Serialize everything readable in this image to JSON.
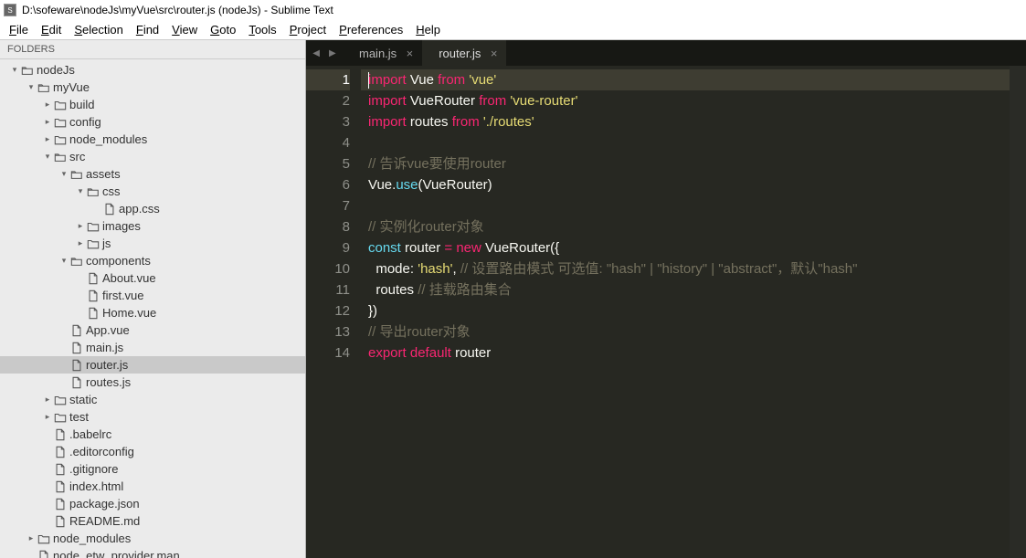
{
  "title": "D:\\sofeware\\nodeJs\\myVue\\src\\router.js (nodeJs) - Sublime Text",
  "menu": [
    "File",
    "Edit",
    "Selection",
    "Find",
    "View",
    "Goto",
    "Tools",
    "Project",
    "Preferences",
    "Help"
  ],
  "sidebar": {
    "header": "FOLDERS"
  },
  "tree": [
    {
      "d": 0,
      "t": "folder",
      "a": "down",
      "n": "nodeJs"
    },
    {
      "d": 1,
      "t": "folder",
      "a": "down",
      "n": "myVue"
    },
    {
      "d": 2,
      "t": "folder",
      "a": "right",
      "n": "build"
    },
    {
      "d": 2,
      "t": "folder",
      "a": "right",
      "n": "config"
    },
    {
      "d": 2,
      "t": "folder",
      "a": "right",
      "n": "node_modules"
    },
    {
      "d": 2,
      "t": "folder",
      "a": "down",
      "n": "src"
    },
    {
      "d": 3,
      "t": "folder",
      "a": "down",
      "n": "assets"
    },
    {
      "d": 4,
      "t": "folder",
      "a": "down",
      "n": "css"
    },
    {
      "d": 5,
      "t": "file",
      "a": "",
      "n": "app.css"
    },
    {
      "d": 4,
      "t": "folder",
      "a": "right",
      "n": "images"
    },
    {
      "d": 4,
      "t": "folder",
      "a": "right",
      "n": "js"
    },
    {
      "d": 3,
      "t": "folder",
      "a": "down",
      "n": "components"
    },
    {
      "d": 4,
      "t": "file",
      "a": "",
      "n": "About.vue"
    },
    {
      "d": 4,
      "t": "file",
      "a": "",
      "n": "first.vue"
    },
    {
      "d": 4,
      "t": "file",
      "a": "",
      "n": "Home.vue"
    },
    {
      "d": 3,
      "t": "file",
      "a": "",
      "n": "App.vue"
    },
    {
      "d": 3,
      "t": "file",
      "a": "",
      "n": "main.js"
    },
    {
      "d": 3,
      "t": "file",
      "a": "",
      "n": "router.js",
      "sel": true
    },
    {
      "d": 3,
      "t": "file",
      "a": "",
      "n": "routes.js"
    },
    {
      "d": 2,
      "t": "folder",
      "a": "right",
      "n": "static"
    },
    {
      "d": 2,
      "t": "folder",
      "a": "right",
      "n": "test"
    },
    {
      "d": 2,
      "t": "file",
      "a": "",
      "n": ".babelrc"
    },
    {
      "d": 2,
      "t": "file",
      "a": "",
      "n": ".editorconfig"
    },
    {
      "d": 2,
      "t": "file",
      "a": "",
      "n": ".gitignore"
    },
    {
      "d": 2,
      "t": "file",
      "a": "",
      "n": "index.html"
    },
    {
      "d": 2,
      "t": "file",
      "a": "",
      "n": "package.json"
    },
    {
      "d": 2,
      "t": "file",
      "a": "",
      "n": "README.md"
    },
    {
      "d": 1,
      "t": "folder",
      "a": "right",
      "n": "node_modules"
    },
    {
      "d": 1,
      "t": "file",
      "a": "",
      "n": "node_etw_provider.man"
    }
  ],
  "tabs": [
    {
      "label": "main.js",
      "active": false
    },
    {
      "label": "router.js",
      "active": true
    }
  ],
  "code": {
    "current_line": 1,
    "lines": [
      [
        {
          "c": "kw",
          "t": "import"
        },
        {
          "c": "pun",
          "t": " Vue "
        },
        {
          "c": "kw",
          "t": "from"
        },
        {
          "c": "pun",
          "t": " "
        },
        {
          "c": "str",
          "t": "'vue'"
        }
      ],
      [
        {
          "c": "kw",
          "t": "import"
        },
        {
          "c": "pun",
          "t": " VueRouter "
        },
        {
          "c": "kw",
          "t": "from"
        },
        {
          "c": "pun",
          "t": " "
        },
        {
          "c": "str",
          "t": "'vue-router'"
        }
      ],
      [
        {
          "c": "kw",
          "t": "import"
        },
        {
          "c": "pun",
          "t": " routes "
        },
        {
          "c": "kw",
          "t": "from"
        },
        {
          "c": "pun",
          "t": " "
        },
        {
          "c": "str",
          "t": "'./routes'"
        }
      ],
      [],
      [
        {
          "c": "com",
          "t": "// 告诉vue要使用router"
        }
      ],
      [
        {
          "c": "pun",
          "t": "Vue."
        },
        {
          "c": "fn",
          "t": "use"
        },
        {
          "c": "pun",
          "t": "(VueRouter)"
        }
      ],
      [],
      [
        {
          "c": "com",
          "t": "// 实例化router对象"
        }
      ],
      [
        {
          "c": "fn",
          "t": "const"
        },
        {
          "c": "pun",
          "t": " router "
        },
        {
          "c": "kw",
          "t": "="
        },
        {
          "c": "pun",
          "t": " "
        },
        {
          "c": "kw",
          "t": "new"
        },
        {
          "c": "pun",
          "t": " VueRouter({"
        }
      ],
      [
        {
          "c": "pun",
          "t": "  mode: "
        },
        {
          "c": "str",
          "t": "'hash'"
        },
        {
          "c": "pun",
          "t": ", "
        },
        {
          "c": "com",
          "t": "// 设置路由模式 可选值: \"hash\" | \"history\" | \"abstract\"，默认\"hash\""
        }
      ],
      [
        {
          "c": "pun",
          "t": "  routes "
        },
        {
          "c": "com",
          "t": "// 挂载路由集合"
        }
      ],
      [
        {
          "c": "pun",
          "t": "})"
        }
      ],
      [
        {
          "c": "com",
          "t": "// 导出router对象"
        }
      ],
      [
        {
          "c": "kw",
          "t": "export"
        },
        {
          "c": "pun",
          "t": " "
        },
        {
          "c": "kw",
          "t": "default"
        },
        {
          "c": "pun",
          "t": " router"
        }
      ]
    ]
  }
}
